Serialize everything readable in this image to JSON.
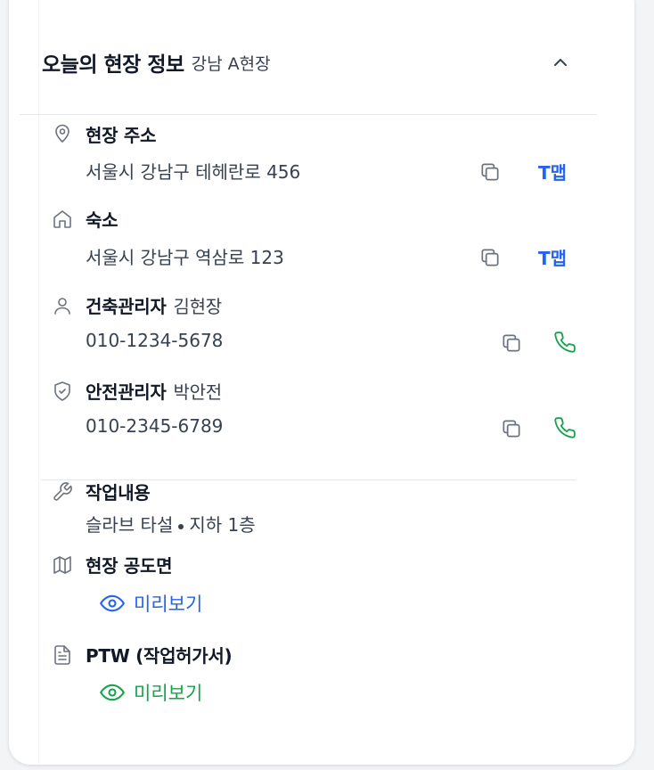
{
  "header": {
    "title": "오늘의 현장 정보",
    "site_name": "강남 A현장"
  },
  "address": {
    "label": "현장 주소",
    "value": "서울시 강남구 테헤란로 456",
    "map_button": "T맵"
  },
  "lodging": {
    "label": "숙소",
    "value": "서울시 강남구 역삼로 123",
    "map_button": "T맵"
  },
  "construction_manager": {
    "label": "건축관리자",
    "name": "김현장",
    "phone": "010-1234-5678"
  },
  "safety_manager": {
    "label": "안전관리자",
    "name": "박안전",
    "phone": "010-2345-6789"
  },
  "work": {
    "label": "작업내용",
    "task": "슬라브 타설",
    "location": "지하 1층"
  },
  "drawing": {
    "label": "현장 공도면",
    "preview": "미리보기"
  },
  "ptw": {
    "label": "PTW (작업허가서)",
    "preview": "미리보기"
  },
  "colors": {
    "accent_blue": "#2563eb",
    "call_green": "#16a34a",
    "icon_gray": "#6b7280"
  }
}
